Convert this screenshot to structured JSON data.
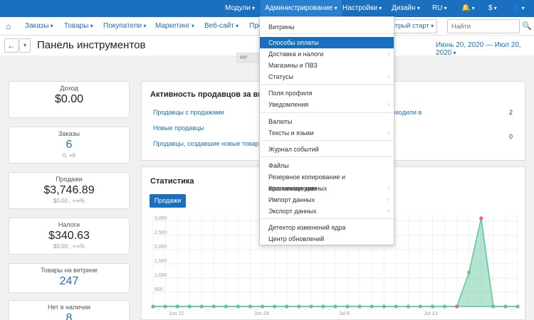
{
  "topbar": {
    "modules": "Модули",
    "admin": "Администрирование",
    "settings": "Настройки",
    "design": "Дизайн",
    "lang": "RU",
    "bell": "🔔",
    "currency": "$",
    "user": "👤"
  },
  "nav": {
    "home_icon": "⌂",
    "orders": "Заказы",
    "products": "Товары",
    "customers": "Покупатели",
    "marketing": "Маркетинг",
    "website": "Веб-сайт",
    "promo_partial": "Про",
    "quick_start": "Быстрый старт",
    "search_placeholder": "Найти",
    "search_icon": "🔍"
  },
  "header": {
    "back_icon": "←",
    "title": "Панель инструментов",
    "date_range": "Июнь 20, 2020 — Июл 20, 2020",
    "notice": "НУ"
  },
  "stats": [
    {
      "label": "Доход",
      "value": "$0.00",
      "sub": ""
    },
    {
      "label": "Заказы",
      "value": "6",
      "sub": "0, +6"
    },
    {
      "label": "Продажи",
      "value": "$3,746.89",
      "sub": "$0.00 , +∞%"
    },
    {
      "label": "Налоги",
      "value": "$340.63",
      "sub": "$0.00 , +∞%"
    },
    {
      "label": "Товары на витрине",
      "value": "247",
      "sub": ""
    },
    {
      "label": "Нет в наличии",
      "value": "8",
      "sub": ""
    }
  ],
  "activity": {
    "title": "Активность продавцов за выбра",
    "rows": [
      {
        "label": "Продавцы с продажами"
      },
      {
        "label": "Новые продавцы"
      },
      {
        "label": "Продавцы, создавшие новые товары"
      }
    ],
    "right_text": "е входили в",
    "right_values": [
      "2",
      "0"
    ]
  },
  "statistics": {
    "title": "Статистика",
    "button": "Продажи"
  },
  "chart_data": {
    "type": "area",
    "y_ticks": [
      "3,000",
      "2,500",
      "2,000",
      "1,500",
      "1,000",
      "500"
    ],
    "ylim": [
      0,
      3000
    ],
    "x_tick_labels": [
      "Jun 22",
      "Jun 29",
      "Jul 6",
      "Jul 13"
    ],
    "x": [
      "Jun 20",
      "Jun 21",
      "Jun 22",
      "Jun 23",
      "Jun 24",
      "Jun 25",
      "Jun 26",
      "Jun 27",
      "Jun 28",
      "Jun 29",
      "Jun 30",
      "Jul 1",
      "Jul 2",
      "Jul 3",
      "Jul 4",
      "Jul 5",
      "Jul 6",
      "Jul 7",
      "Jul 8",
      "Jul 9",
      "Jul 10",
      "Jul 11",
      "Jul 12",
      "Jul 13",
      "Jul 14",
      "Jul 15",
      "Jul 16",
      "Jul 17",
      "Jul 18",
      "Jul 19",
      "Jul 20"
    ],
    "series": [
      {
        "values": [
          0,
          0,
          0,
          0,
          0,
          0,
          0,
          0,
          0,
          0,
          0,
          0,
          0,
          0,
          0,
          0,
          0,
          0,
          0,
          0,
          0,
          0,
          0,
          0,
          0,
          0,
          1200,
          3100,
          0,
          0,
          0
        ],
        "color": "#5cc59a"
      },
      {
        "values": [
          0,
          0,
          0,
          0,
          0,
          0,
          0,
          0,
          0,
          0,
          0,
          0,
          0,
          0,
          0,
          0,
          0,
          0,
          0,
          0,
          0,
          0,
          0,
          0,
          0,
          0,
          0,
          0,
          0,
          0,
          0
        ],
        "color": "#e86a6a"
      }
    ]
  },
  "dropdown": {
    "items": [
      {
        "label": "Витрины",
        "arrow": false
      },
      {
        "label": "Способы оплаты",
        "arrow": false,
        "selected": true
      },
      {
        "label": "Доставка и налоги",
        "arrow": true
      },
      {
        "label": "Магазины и ПВЗ",
        "arrow": false
      },
      {
        "label": "Статусы",
        "arrow": true
      },
      {
        "label": "Поля профиля",
        "arrow": false
      },
      {
        "label": "Уведомления",
        "arrow": true
      },
      {
        "label": "Валюты",
        "arrow": false
      },
      {
        "label": "Тексты и языки",
        "arrow": true
      },
      {
        "label": "Журнал событий",
        "arrow": false
      },
      {
        "label": "Файлы",
        "arrow": false
      },
      {
        "label": "Резервное копирование и восстановление",
        "arrow": false
      },
      {
        "label": "Хранилище данных",
        "arrow": true
      },
      {
        "label": "Импорт данных",
        "arrow": true
      },
      {
        "label": "Экспорт данных",
        "arrow": true
      },
      {
        "label": "Детектор изменений ядра",
        "arrow": false
      },
      {
        "label": "Центр обновлений",
        "arrow": false
      }
    ]
  },
  "colors": {
    "brand": "#1a6fbe",
    "chart_green": "#5cc59a",
    "chart_red": "#e86a6a"
  }
}
